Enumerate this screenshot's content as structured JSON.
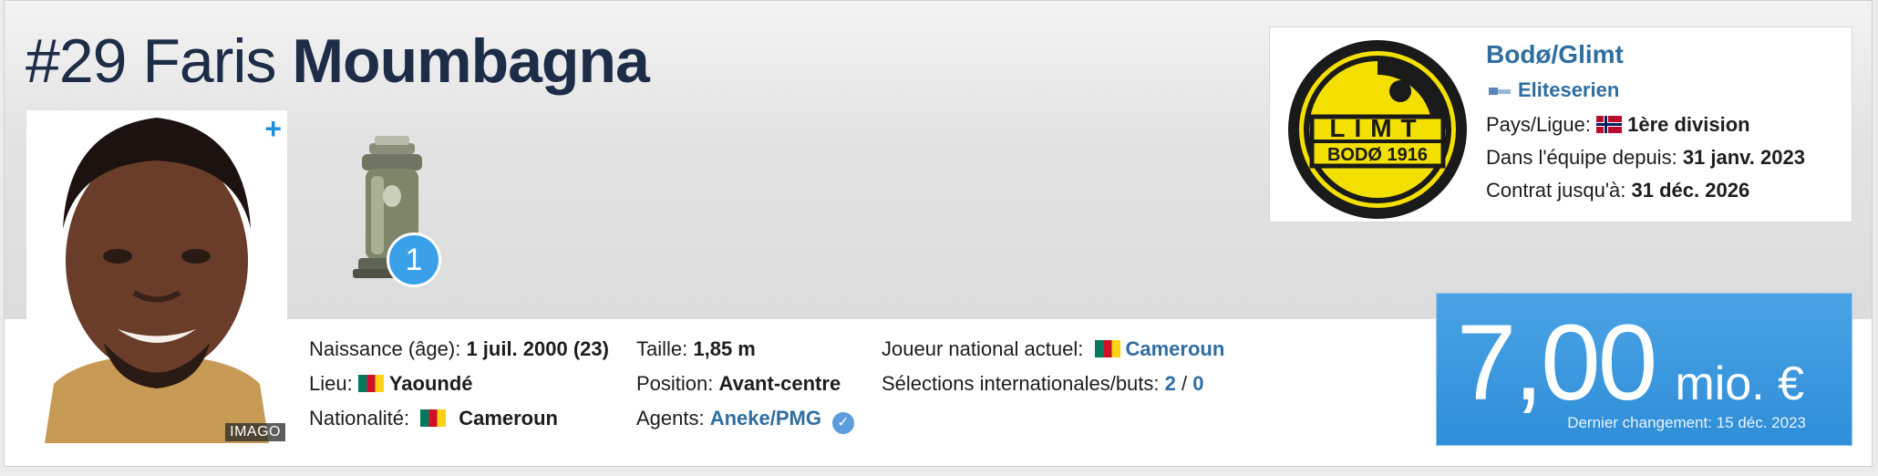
{
  "header": {
    "number": "#29",
    "first_name": "Faris",
    "last_name": "Moumbagna"
  },
  "photo": {
    "plus": "+",
    "credit": "IMAGO"
  },
  "trophy": {
    "count": "1",
    "icon": "trophy-icon"
  },
  "club": {
    "name": "Bodø/Glimt",
    "league": "Eliteserien",
    "logo_text_top": "LIMT",
    "logo_text_bottom": "BODØ 1916",
    "country_label": "Pays/Ligue:",
    "country_value": "1ère division",
    "since_label": "Dans l'équipe depuis:",
    "since_value": "31 janv. 2023",
    "contract_label": "Contrat jusqu'à:",
    "contract_value": "31 déc. 2026"
  },
  "info": {
    "birth_label": "Naissance (âge):",
    "birth_value": "1 juil. 2000 (23)",
    "place_label": "Lieu:",
    "place_value": "Yaoundé",
    "nationality_label": "Nationalité:",
    "nationality_value": "Cameroun",
    "height_label": "Taille:",
    "height_value": "1,85 m",
    "position_label": "Position:",
    "position_value": "Avant-centre",
    "agents_label": "Agents:",
    "agents_value": "Aneke/PMG",
    "national_label": "Joueur national actuel:",
    "national_value": "Cameroun",
    "caps_label": "Sélections internationales/buts:",
    "caps_value": "2",
    "caps_sep": "/",
    "goals_value": "0"
  },
  "market_value": {
    "amount": "7,00",
    "unit": "mio. €",
    "note": "Dernier changement: 15 déc. 2023"
  },
  "colors": {
    "link": "#2f6ea0",
    "value_bg": "#3a97de",
    "title": "#1d2c47"
  }
}
